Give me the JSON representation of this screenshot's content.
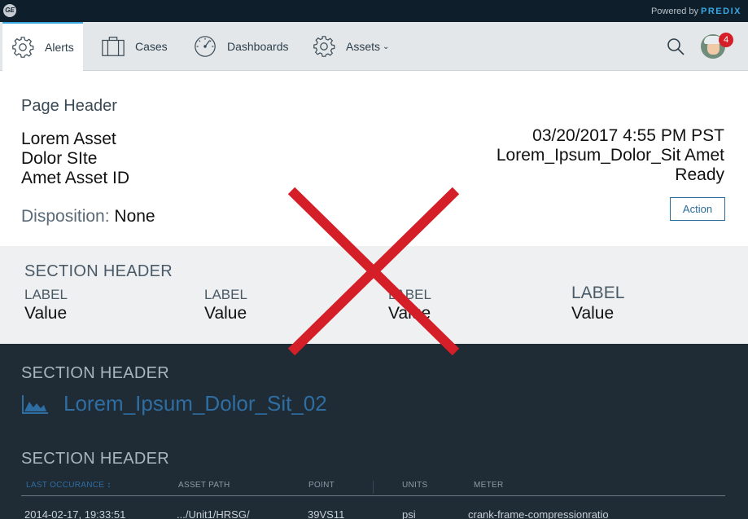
{
  "brand": {
    "logo_text": "GE",
    "powered_by": "Powered by",
    "product": "PREDIX",
    "colors": {
      "bar": "#0e1f2b",
      "product": "#3aa6e0"
    }
  },
  "nav": {
    "items": [
      {
        "label": "Alerts",
        "icon": "gear-icon",
        "active": true
      },
      {
        "label": "Cases",
        "icon": "cases-icon",
        "active": false
      },
      {
        "label": "Dashboards",
        "icon": "gauge-icon",
        "active": false
      },
      {
        "label": "Assets",
        "icon": "gear-icon",
        "active": false,
        "has_dropdown": true
      }
    ],
    "search_icon": "search-icon",
    "notifications_count": "4"
  },
  "page_header": {
    "title": "Page Header",
    "asset_name": "Lorem Asset",
    "site": "Dolor SIte",
    "asset_id": "Amet Asset ID",
    "disposition_label": "Disposition:",
    "disposition_value": "None",
    "timestamp": "03/20/2017 4:55 PM PST",
    "subtitle": "Lorem_Ipsum_Dolor_Sit Amet",
    "status": "Ready",
    "action_label": "Action"
  },
  "section_light": {
    "header": "SECTION HEADER",
    "fields": [
      {
        "label": "LABEL",
        "value": "Value"
      },
      {
        "label": "LABEL",
        "value": "Value"
      },
      {
        "label": "LABEL",
        "value": "Value"
      },
      {
        "label": "LABEL",
        "value": "Value"
      }
    ]
  },
  "section_dark": {
    "header1": "SECTION HEADER",
    "link_text": "Lorem_Ipsum_Dolor_Sit_02",
    "link_icon": "area-chart-icon",
    "header2": "SECTION HEADER",
    "table": {
      "columns": [
        "LAST OCCURANCE",
        "ASSET PATH",
        "POINT",
        "UNITS",
        "METER"
      ],
      "sort_indicator": "↕",
      "rows": [
        [
          "2014-02-17, 19:33:51",
          ".../Unit1/HRSG/",
          "39VS11",
          "psi",
          "crank-frame-compressionratio"
        ]
      ]
    }
  },
  "overlay": {
    "icon": "placeholder-x-icon",
    "color": "#d41f28"
  }
}
